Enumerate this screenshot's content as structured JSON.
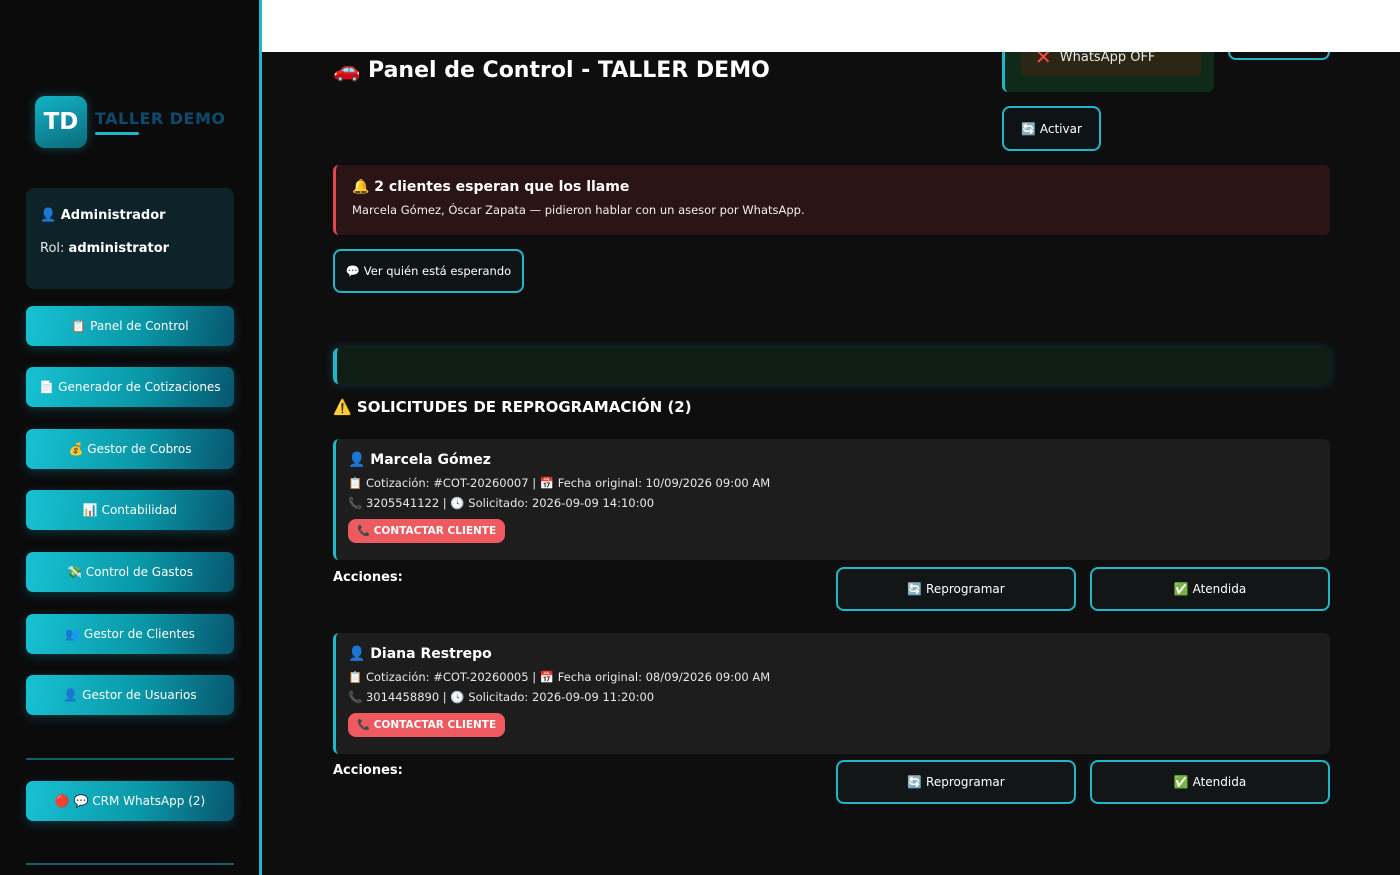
{
  "brand": {
    "badge": "TD",
    "name": "TALLER DEMO"
  },
  "user": {
    "name": "👤 Administrador",
    "role_label": "Rol:",
    "role_value": "administrator"
  },
  "nav": {
    "panel": "📋 Panel de Control",
    "cotizaciones": "📄 Generador de Cotizaciones",
    "cobros": "💰 Gestor de Cobros",
    "contabilidad": "📊 Contabilidad",
    "gastos": "💸 Control de Gastos",
    "clientes": "👥 Gestor de Clientes",
    "usuarios": "👤 Gestor de Usuarios",
    "crm": "🔴 💬 CRM WhatsApp (2)"
  },
  "header": {
    "title": "🚗 Panel de Control - TALLER DEMO",
    "whatsapp_status": "WhatsApp OFF",
    "activate_button": "🔄 Activar"
  },
  "alert": {
    "title": "🔔 2 clientes esperan que los llame",
    "text": "Marcela Gómez, Óscar Zapata — pidieron hablar con un asesor por WhatsApp.",
    "button": "💬 Ver quién está esperando"
  },
  "section": {
    "title": "⚠️ SOLICITUDES DE REPROGRAMACIÓN (2)"
  },
  "requests": [
    {
      "name": "👤 Marcela Gómez",
      "line1": "📋 Cotización: #COT-20260007 | 📅 Fecha original: 10/09/2026 09:00 AM",
      "line2": "📞 3205541122 | 🕓 Solicitado: 2026-09-09 14:10:00",
      "contact": "📞 CONTACTAR CLIENTE",
      "actions_label": "Acciones:",
      "reschedule": "🔄 Reprogramar",
      "attended": "✅ Atendida"
    },
    {
      "name": "👤 Diana Restrepo",
      "line1": "📋 Cotización: #COT-20260005 | 📅 Fecha original: 08/09/2026 09:00 AM",
      "line2": "📞 3014458890 | 🕓 Solicitado: 2026-09-09 11:20:00",
      "contact": "📞 CONTACTAR CLIENTE",
      "actions_label": "Acciones:",
      "reschedule": "🔄 Reprogramar",
      "attended": "✅ Atendida"
    }
  ]
}
